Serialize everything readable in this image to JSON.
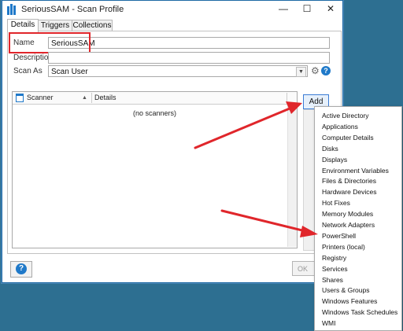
{
  "window": {
    "title": "SeriousSAM - Scan Profile",
    "controls": [
      "—",
      "☐",
      "✕"
    ]
  },
  "tabs": [
    {
      "label": "Details",
      "active": true
    },
    {
      "label": "Triggers",
      "active": false
    },
    {
      "label": "Collections",
      "active": false
    }
  ],
  "form": {
    "name_label": "Name",
    "name_value": "SeriousSAM",
    "description_label": "Description",
    "description_value": "",
    "scan_as_label": "Scan As",
    "scan_as_value": "Scan User"
  },
  "grid": {
    "columns": [
      "Scanner",
      "Details"
    ],
    "empty_text": "(no scanners)"
  },
  "buttons": {
    "add": "Add",
    "help": "?",
    "ok": "OK"
  },
  "add_menu": {
    "items": [
      "Active Directory",
      "Applications",
      "Computer Details",
      "Disks",
      "Displays",
      "Environment Variables",
      "Files & Directories",
      "Hardware Devices",
      "Hot Fixes",
      "Memory Modules",
      "Network Adapters",
      "PowerShell",
      "Printers (local)",
      "Registry",
      "Services",
      "Shares",
      "Users & Groups",
      "Windows Features",
      "Windows Task Schedules",
      "WMI"
    ]
  },
  "colors": {
    "desktop": "#2d6f91",
    "accent": "#1f79c9",
    "annotation": "#e0262b"
  }
}
